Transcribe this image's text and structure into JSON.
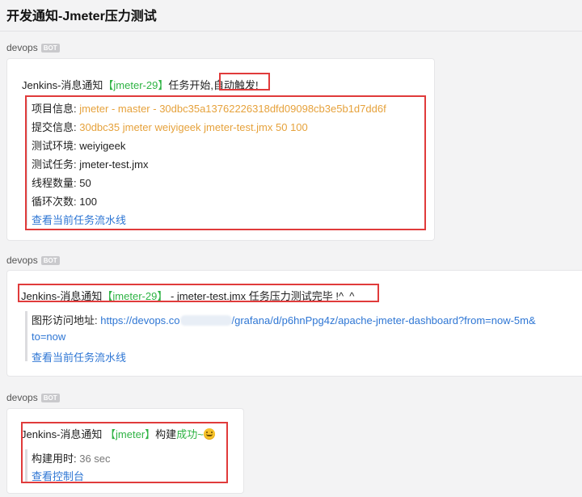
{
  "header": {
    "title": "开发通知-Jmeter压力测试"
  },
  "messages": [
    {
      "sender": "devops",
      "badge": "BOT",
      "prefix": "Jenkins-消息通知",
      "tag": "【jmeter-29】",
      "action": "任务开始,",
      "trigger": "自动触发!",
      "fields": [
        {
          "label": "项目信息: ",
          "value": "jmeter - master - 30dbc35a13762226318dfd09098cb3e5b1d7dd6f"
        },
        {
          "label": "提交信息: ",
          "value": "30dbc35 jmeter weiyigeek jmeter-test.jmx 50 100"
        },
        {
          "label": "测试环境: ",
          "value": "weiyigeek"
        },
        {
          "label": "测试任务: ",
          "value": "jmeter-test.jmx"
        },
        {
          "label": "线程数量: ",
          "value": "50"
        },
        {
          "label": "循环次数: ",
          "value": "100"
        }
      ],
      "link": "查看当前任务流水线"
    },
    {
      "sender": "devops",
      "badge": "BOT",
      "prefix": "Jenkins-消息通知",
      "tag": "【jmeter-29】",
      "rest": " - jmeter-test.jmx 任务压力测试完毕 !^_^",
      "url_label": "图形访问地址: ",
      "url_start": "https://devops.co",
      "url_end": "/grafana/d/p6hnPpg4z/apache-jmeter-dashboard?from=now-5m&",
      "url_wrap": "to=now",
      "link": "查看当前任务流水线"
    },
    {
      "sender": "devops",
      "badge": "BOT",
      "prefix": "Jenkins-消息通知",
      "tag": "【jmeter】",
      "action": "构建",
      "status": "成功~",
      "emoji": "smiling-face-icon",
      "duration_label": "构建用时: ",
      "duration_value": "36 sec",
      "link": "查看控制台"
    }
  ],
  "colors": {
    "highlight": "#e03b3b",
    "tag": "#2fb344",
    "link": "#2e76d4",
    "commit": "#e6a23c"
  }
}
